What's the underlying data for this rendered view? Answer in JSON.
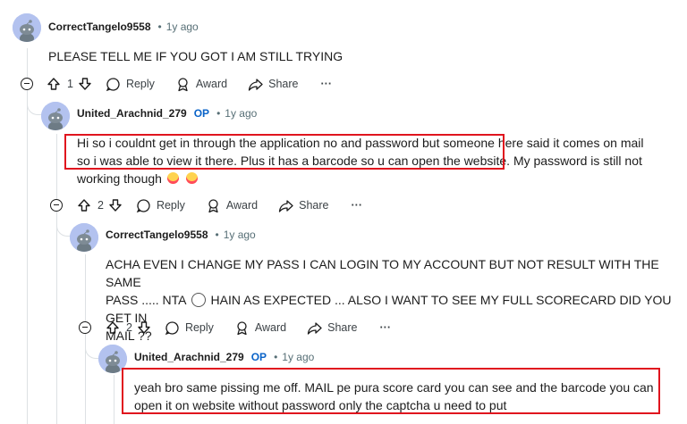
{
  "comments": [
    {
      "author": "CorrectTangelo9558",
      "op_badge": "",
      "time": "1y ago",
      "body": "PLEASE TELL ME IF YOU GOT I AM STILL TRYING",
      "votes": "1"
    },
    {
      "author": "United_Arachnid_279",
      "op_badge": "OP",
      "time": "1y ago",
      "body_line1_hl": "Hi so i couldnt get in through the application no and password but someone here said it comes on mail",
      "body_line2_hl": "so i was able to view it there. Plus it has a barcode so u can open the website.",
      "body_line2_rest": " My password is still not",
      "body_line3": "working though",
      "votes": "2"
    },
    {
      "author": "CorrectTangelo9558",
      "op_badge": "",
      "time": "1y ago",
      "body_line1": "ACHA EVEN I CHANGE MY PASS I CAN LOGIN TO MY ACCOUNT BUT NOT RESULT WITH THE SAME",
      "body_line2a": "PASS ..... NTA",
      "body_line2b": "HAIN AS EXPECTED ... ALSO I WANT TO SEE MY FULL SCORECARD DID YOU GET IN",
      "body_line3": "MAIL ??",
      "votes": "2"
    },
    {
      "author": "United_Arachnid_279",
      "op_badge": "OP",
      "time": "1y ago",
      "body_line1": "yeah bro same pissing me off. MAIL pe pura score card you can see and the barcode you can",
      "body_line2": "open it on website without password only the captcha u need to put"
    }
  ],
  "actions": {
    "reply": "Reply",
    "award": "Award",
    "share": "Share",
    "more": "···"
  },
  "colors": {
    "highlight": "#e0141e",
    "op": "#0a63c8",
    "meta": "#576f76",
    "avatar": "#b3c2ef"
  }
}
